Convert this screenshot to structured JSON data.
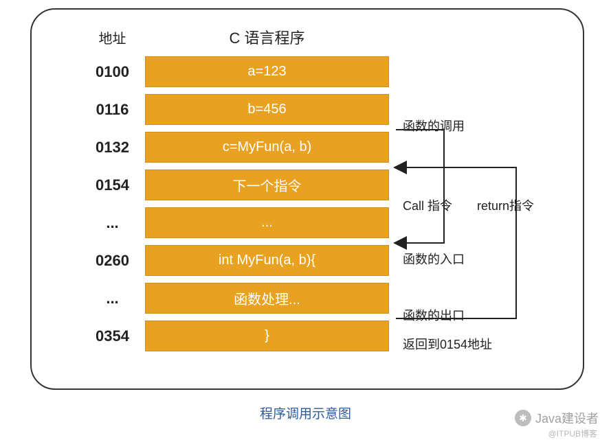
{
  "headers": {
    "address": "地址",
    "program": "C 语言程序"
  },
  "rows": [
    {
      "addr": "0100",
      "code": "a=123"
    },
    {
      "addr": "0116",
      "code": "b=456"
    },
    {
      "addr": "0132",
      "code": "c=MyFun(a, b)"
    },
    {
      "addr": "0154",
      "code": "下一个指令"
    },
    {
      "addr": "...",
      "code": "..."
    },
    {
      "addr": "0260",
      "code": "int MyFun(a, b){"
    },
    {
      "addr": "...",
      "code": "函数处理..."
    },
    {
      "addr": "0354",
      "code": "}"
    }
  ],
  "annotations": {
    "call_of_function": "函数的调用",
    "call_instruction": "Call 指令",
    "return_instruction": "return指令",
    "function_entry": "函数的入口",
    "function_exit": "函数的出口",
    "return_to_text": "返回到0154地址"
  },
  "caption": "程序调用示意图",
  "watermark": "Java建设者",
  "attribution": "@ITPUB博客",
  "colors": {
    "bar_bg": "#e9a122",
    "bar_text": "#ffffff",
    "caption": "#2a5b9e"
  }
}
